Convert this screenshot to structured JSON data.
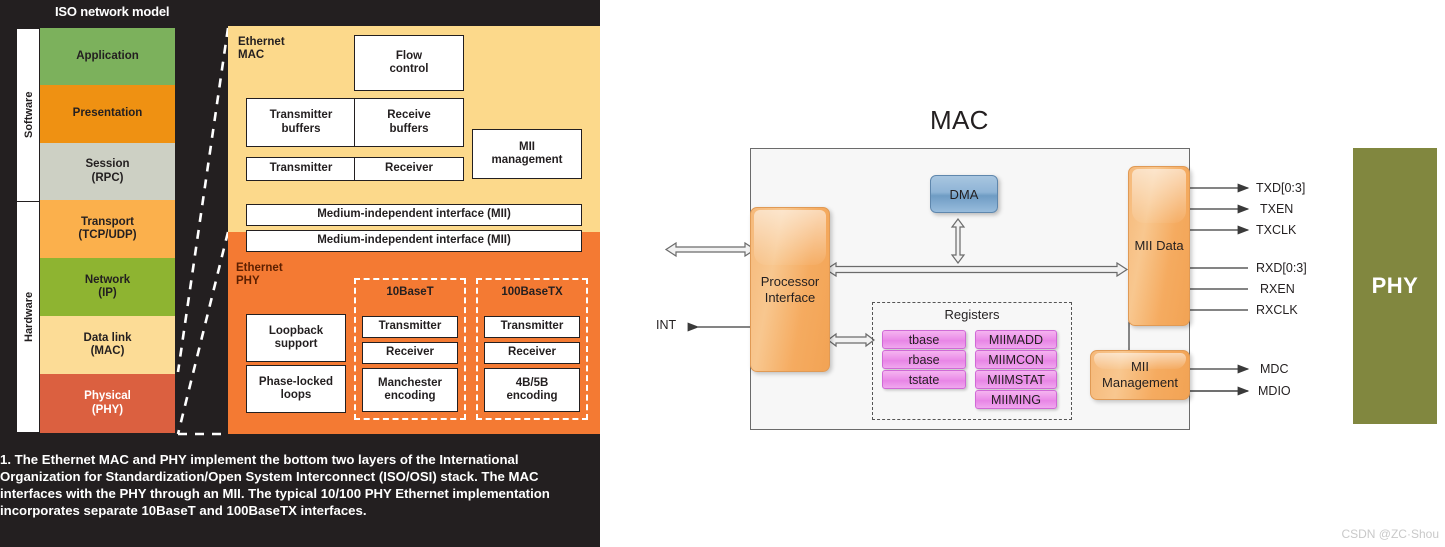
{
  "figure": {
    "title": "ISO network model",
    "caption": "1. The Ethernet MAC and PHY implement the bottom two layers of the International Organization for Standardization/Open System Interconnect (ISO/OSI) stack. The MAC interfaces with the PHY through an MII. The typical 10/100 PHY Ethernet implementation incorporates separate 10BaseT and 100BaseTX interfaces.",
    "bracket": {
      "software_label": "Software",
      "hardware_label": "Hardware"
    },
    "iso_layers": [
      {
        "label": "Application",
        "color": "#7cb15c",
        "text_color": "#231f20"
      },
      {
        "label": "Presentation",
        "color": "#ef9112",
        "text_color": "#231f20"
      },
      {
        "label": "Session\n(RPC)",
        "color": "#cdd0c4",
        "text_color": "#231f20"
      },
      {
        "label": "Transport\n(TCP/UDP)",
        "color": "#fbb04c",
        "text_color": "#231f20"
      },
      {
        "label": "Network\n(IP)",
        "color": "#8eb431",
        "text_color": "#231f20"
      },
      {
        "label": "Data link\n(MAC)",
        "color": "#fcdc96",
        "text_color": "#231f20"
      },
      {
        "label": "Physical\n(PHY)",
        "color": "#db6040",
        "text_color": "#ffffff"
      }
    ],
    "ethernet_mac": {
      "label": "Ethernet\nMAC",
      "bg_color": "#fcd98b",
      "boxes": [
        "Flow\ncontrol",
        "Transmitter\nbuffers",
        "Receive\nbuffers",
        "MII\nmanagement",
        "Transmitter",
        "Receiver"
      ],
      "mii_bar": "Medium-independent interface (MII)"
    },
    "ethernet_phy": {
      "label": "Ethernet\nPHY",
      "bg_color": "#f47a33",
      "mii_bar": "Medium-independent interface (MII)",
      "left_boxes": [
        "Loopback\nsupport",
        "Phase-locked\nloops"
      ],
      "groups": [
        {
          "title": "10BaseT",
          "boxes": [
            "Transmitter",
            "Receiver",
            "Manchester\nencoding"
          ]
        },
        {
          "title": "100BaseTX",
          "boxes": [
            "Transmitter",
            "Receiver",
            "4B/5B\nencoding"
          ]
        }
      ]
    }
  },
  "mac_diagram": {
    "title": "MAC",
    "processor_interface": "Processor\nInterface",
    "int_label": "INT",
    "dma": "DMA",
    "registers": {
      "title": "Registers",
      "col_left": [
        "tbase",
        "rbase",
        "tstate"
      ],
      "col_right": [
        "MIIMADD",
        "MIIMCON",
        "MIIMSTAT",
        "MIIMING"
      ]
    },
    "mii_data": "MII Data",
    "mii_management": "MII\nManagement",
    "phy": "PHY",
    "signals_tx": [
      "TXD[0:3]",
      "TXEN",
      "TXCLK"
    ],
    "signals_rx": [
      "RXD[0:3]",
      "RXEN",
      "RXCLK"
    ],
    "signals_mgmt": [
      "MDC",
      "MDIO"
    ],
    "colors": {
      "orange": "#f5ab60",
      "blue": "#8fb4d6",
      "pink": "#eb8ee8",
      "olive": "#81873f",
      "panel": "#f7f7f7"
    }
  },
  "watermark": "CSDN @ZC·Shou"
}
